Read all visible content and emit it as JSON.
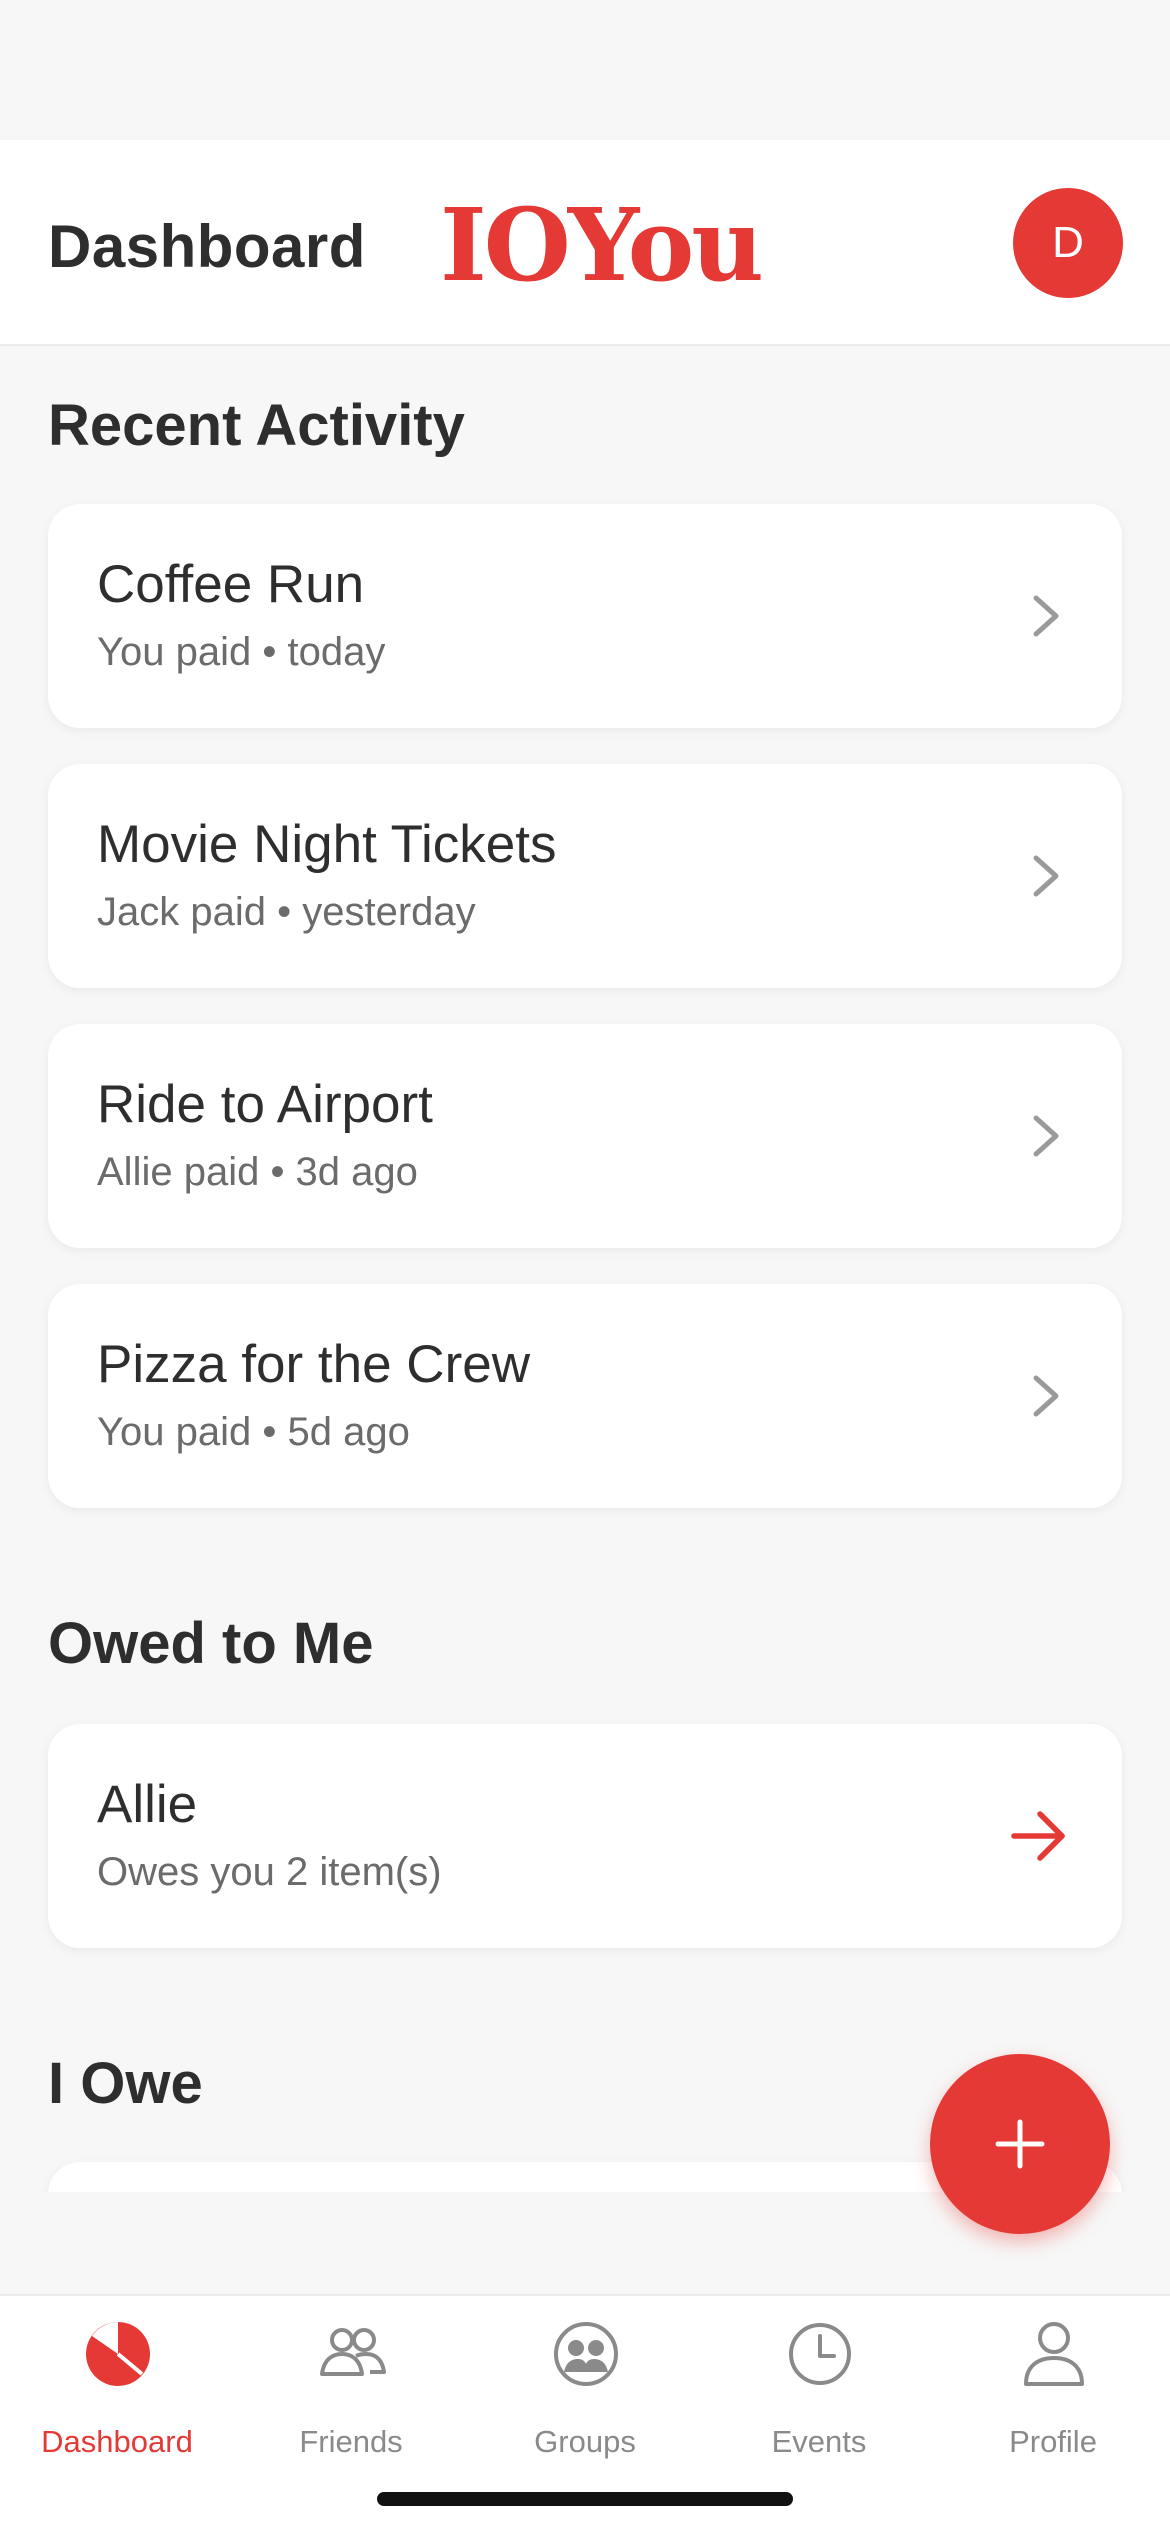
{
  "header": {
    "title": "Dashboard",
    "logo": "IOYou",
    "avatar_initial": "D"
  },
  "recent_activity": {
    "title": "Recent Activity",
    "items": [
      {
        "title": "Coffee Run",
        "subtitle": "You paid • today"
      },
      {
        "title": "Movie Night Tickets",
        "subtitle": "Jack paid • yesterday"
      },
      {
        "title": "Ride to Airport",
        "subtitle": "Allie paid • 3d ago"
      },
      {
        "title": "Pizza for the Crew",
        "subtitle": "You paid • 5d ago"
      }
    ]
  },
  "owed_to_me": {
    "title": "Owed to Me",
    "items": [
      {
        "title": "Allie",
        "subtitle": "Owes you 2 item(s)"
      }
    ]
  },
  "i_owe": {
    "title": "I Owe"
  },
  "fab": {
    "icon": "plus-icon"
  },
  "tabs": [
    {
      "label": "Dashboard",
      "icon": "dashboard-pie-icon",
      "active": true
    },
    {
      "label": "Friends",
      "icon": "friends-icon",
      "active": false
    },
    {
      "label": "Groups",
      "icon": "groups-icon",
      "active": false
    },
    {
      "label": "Events",
      "icon": "clock-icon",
      "active": false
    },
    {
      "label": "Profile",
      "icon": "person-icon",
      "active": false
    }
  ],
  "colors": {
    "accent": "#e53935",
    "background": "#f7f7f7",
    "card": "#ffffff",
    "text": "#2e2e2e",
    "muted": "#6b6b6b",
    "tab_inactive": "#8a8a8a"
  }
}
